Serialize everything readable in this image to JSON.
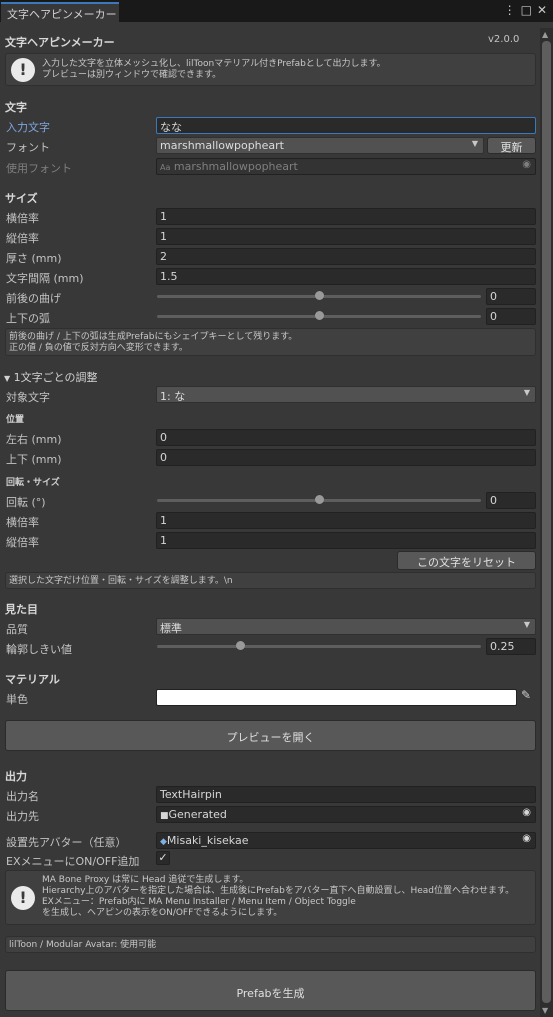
{
  "window": {
    "tab_title": "文字ヘアピンメーカー",
    "menu_icon": "kebab-menu-icon",
    "maximize_icon": "maximize-icon",
    "close_icon": "close-icon"
  },
  "header": {
    "title": "文字ヘアピンメーカー",
    "version": "v2.0.0",
    "help": "入力した文字を立体メッシュ化し、lilToonマテリアル付きPrefabとして出力します。\nプレビューは別ウィンドウで確認できます。"
  },
  "text_section": {
    "title": "文字",
    "input_label": "入力文字",
    "input_value": "なな",
    "font_label": "フォント",
    "font_value": "marshmallowpopheart",
    "refresh_button": "更新",
    "used_font_label": "使用フォント",
    "used_font_value": "marshmallowpopheart"
  },
  "size_section": {
    "title": "サイズ",
    "fields": [
      {
        "label": "横倍率",
        "value": "1"
      },
      {
        "label": "縦倍率",
        "value": "1"
      },
      {
        "label": "厚さ (mm)",
        "value": "2"
      },
      {
        "label": "文字間隔 (mm)",
        "value": "1.5"
      }
    ],
    "bend_label": "前後の曲げ",
    "bend_value": "0",
    "bend_pos": 0.5,
    "arc_label": "上下の弧",
    "arc_value": "0",
    "arc_pos": 0.5,
    "help": "前後の曲げ / 上下の弧は生成Prefabにもシェイプキーとして残ります。\n正の値 / 負の値で反対方向へ変形できます。"
  },
  "per_char": {
    "title": "1文字ごとの調整",
    "target_label": "対象文字",
    "target_value": "1: な",
    "position_title": "位置",
    "x_label": "左右 (mm)",
    "x_value": "0",
    "y_label": "上下 (mm)",
    "y_value": "0",
    "rot_title": "回転・サイズ",
    "rot_label": "回転 (°)",
    "rot_value": "0",
    "rot_pos": 0.5,
    "sx_label": "横倍率",
    "sx_value": "1",
    "sy_label": "縦倍率",
    "sy_value": "1",
    "reset_button": "この文字をリセット",
    "help": "選択した文字だけ位置・回転・サイズを調整します。\\n"
  },
  "appearance": {
    "title": "見た目",
    "quality_label": "品質",
    "quality_value": "標準",
    "threshold_label": "輪郭しきい値",
    "threshold_value": "0.25",
    "threshold_pos": 0.25
  },
  "material": {
    "title": "マテリアル",
    "color_label": "単色",
    "color": "#ffffff",
    "preview_button": "プレビューを開く"
  },
  "output": {
    "title": "出力",
    "name_label": "出力名",
    "name_value": "TextHairpin",
    "dest_label": "出力先",
    "dest_value": "Generated",
    "avatar_label": "設置先アバター（任意）",
    "avatar_value": "Misaki_kisekae",
    "ex_label": "EXメニューにON/OFF追加",
    "ex_checked": "✓",
    "help": "MA Bone Proxy は常に Head 追従で生成します。\nHierarchy上のアバターを指定した場合は、生成後にPrefabをアバター直下へ自動設置し、Head位置へ合わせます。\nEXメニュー：Prefab内に MA Menu Installer / Menu Item / Object Toggle\nを生成し、ヘアピンの表示をON/OFFできるようにします。",
    "status": "lilToon / Modular Avatar: 使用可能",
    "generate_button": "Prefabを生成"
  }
}
